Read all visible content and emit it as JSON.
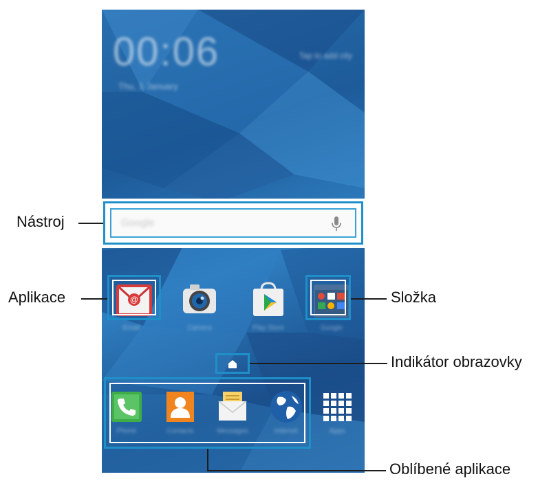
{
  "home_screen": {
    "clock": "00:06",
    "date": "Thu, 1 January",
    "tap_hint": "Tap to add city",
    "search_placeholder": "Google",
    "apps": [
      {
        "label": "Email",
        "icon": "email-icon"
      },
      {
        "label": "Camera",
        "icon": "camera-icon"
      },
      {
        "label": "Play Store",
        "icon": "play-store-icon"
      },
      {
        "label": "Google",
        "icon": "folder-icon"
      }
    ],
    "dock": [
      {
        "label": "Phone",
        "icon": "phone-icon"
      },
      {
        "label": "Contacts",
        "icon": "contacts-icon"
      },
      {
        "label": "Messages",
        "icon": "messages-icon"
      },
      {
        "label": "Internet",
        "icon": "internet-icon"
      },
      {
        "label": "Apps",
        "icon": "apps-grid-icon"
      }
    ]
  },
  "callouts": {
    "widget": "Nástroj",
    "application": "Aplikace",
    "folder": "Složka",
    "screen_indicator": "Indikátor obrazovky",
    "favorite_apps": "Oblíbené aplikace"
  },
  "colors": {
    "highlight": "#1f8fc8",
    "wallpaper": "#2a6fae"
  }
}
